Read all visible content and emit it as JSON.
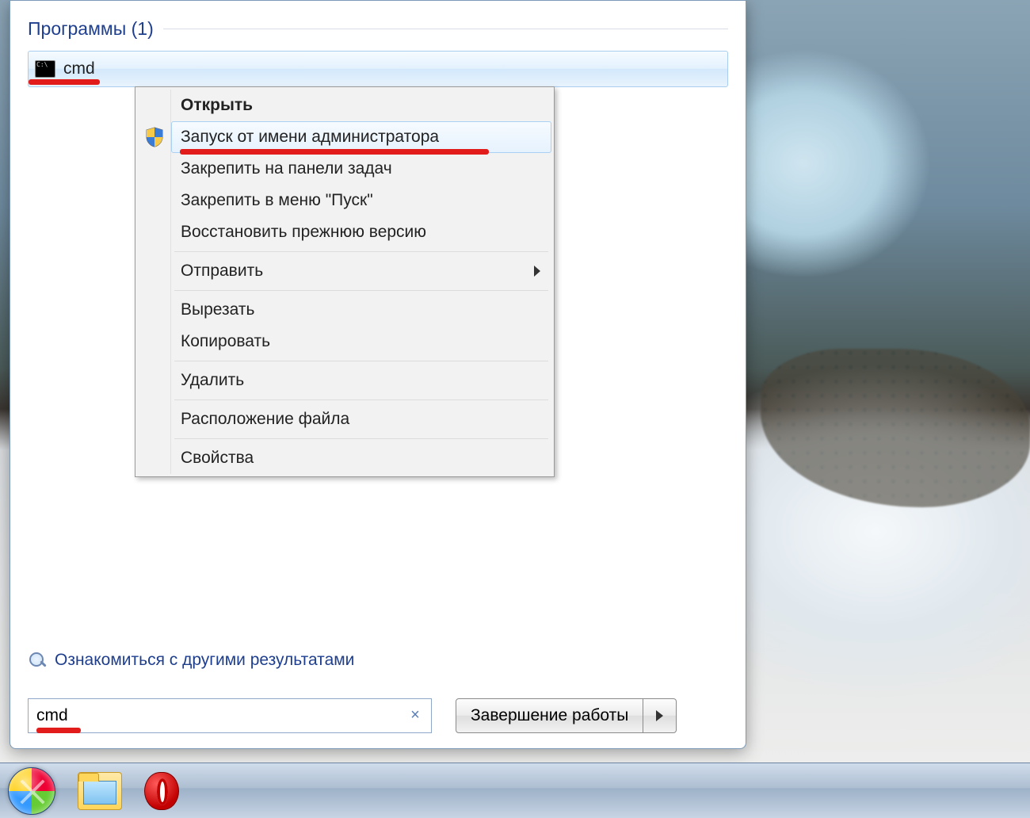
{
  "results": {
    "section_label": "Программы (1)",
    "item_label": "cmd"
  },
  "context_menu": {
    "open": "Открыть",
    "run_as_admin": "Запуск от имени администратора",
    "pin_taskbar": "Закрепить на панели задач",
    "pin_start": "Закрепить в меню \"Пуск\"",
    "restore_prev": "Восстановить прежнюю версию",
    "send_to": "Отправить",
    "cut": "Вырезать",
    "copy": "Копировать",
    "delete": "Удалить",
    "file_location": "Расположение файла",
    "properties": "Свойства"
  },
  "more_results_label": "Ознакомиться с другими результатами",
  "search": {
    "value": "cmd"
  },
  "shutdown_label": "Завершение работы",
  "icons": {
    "cmd": "cmd-icon",
    "shield": "shield-icon",
    "magnifier": "magnifier-icon",
    "clear": "clear-icon",
    "start": "start-orb",
    "explorer": "explorer-icon",
    "opera": "opera-icon",
    "arrow_right": "chevron-right-icon"
  }
}
